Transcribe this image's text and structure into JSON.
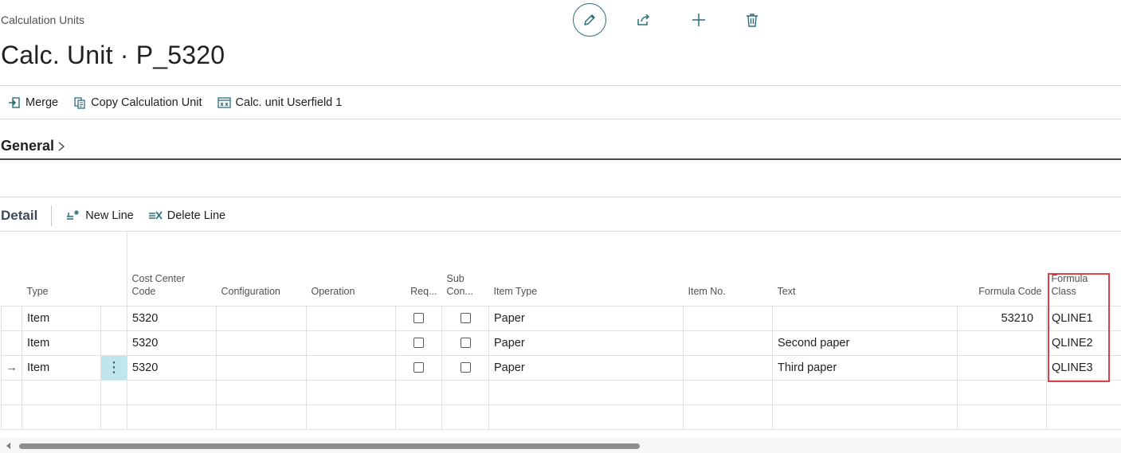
{
  "header": {
    "breadcrumb": "Calculation Units",
    "title": "Calc. Unit · P_5320"
  },
  "top_actions": [
    "edit-icon",
    "share-icon",
    "add-icon",
    "delete-icon"
  ],
  "action_bar": {
    "merge": "Merge",
    "copy": "Copy Calculation Unit",
    "userfield": "Calc. unit Userfield 1"
  },
  "general": {
    "label": "General"
  },
  "detail": {
    "title": "Detail",
    "new_line": "New Line",
    "delete_line": "Delete Line"
  },
  "table": {
    "headers": {
      "type": "Type",
      "cost_center_1": "Cost Center",
      "cost_center_2": "Code",
      "configuration": "Configuration",
      "operation": "Operation",
      "req": "Req...",
      "sub_1": "Sub",
      "sub_2": "Con...",
      "item_type": "Item Type",
      "item_no": "Item No.",
      "text": "Text",
      "formula_code": "Formula Code",
      "formula_class_1": "Formula",
      "formula_class_2": "Class"
    },
    "rows": [
      {
        "type": "Item",
        "cost_center": "5320",
        "configuration": "",
        "operation": "",
        "item_type": "Paper",
        "item_no": "",
        "text": "",
        "formula_code": "53210",
        "formula_class": "QLINE1"
      },
      {
        "type": "Item",
        "cost_center": "5320",
        "configuration": "",
        "operation": "",
        "item_type": "Paper",
        "item_no": "",
        "text": "Second paper",
        "formula_code": "",
        "formula_class": "QLINE2"
      },
      {
        "type": "Item",
        "cost_center": "5320",
        "configuration": "",
        "operation": "",
        "item_type": "Paper",
        "item_no": "",
        "text": "Third paper",
        "formula_code": "",
        "formula_class": "QLINE3"
      }
    ],
    "current_row_marker": "→",
    "row_menu": "⋮"
  },
  "colors": {
    "accent": "#2a6f78",
    "highlight": "#d9414a",
    "selected_cell": "#bfe6ec"
  }
}
